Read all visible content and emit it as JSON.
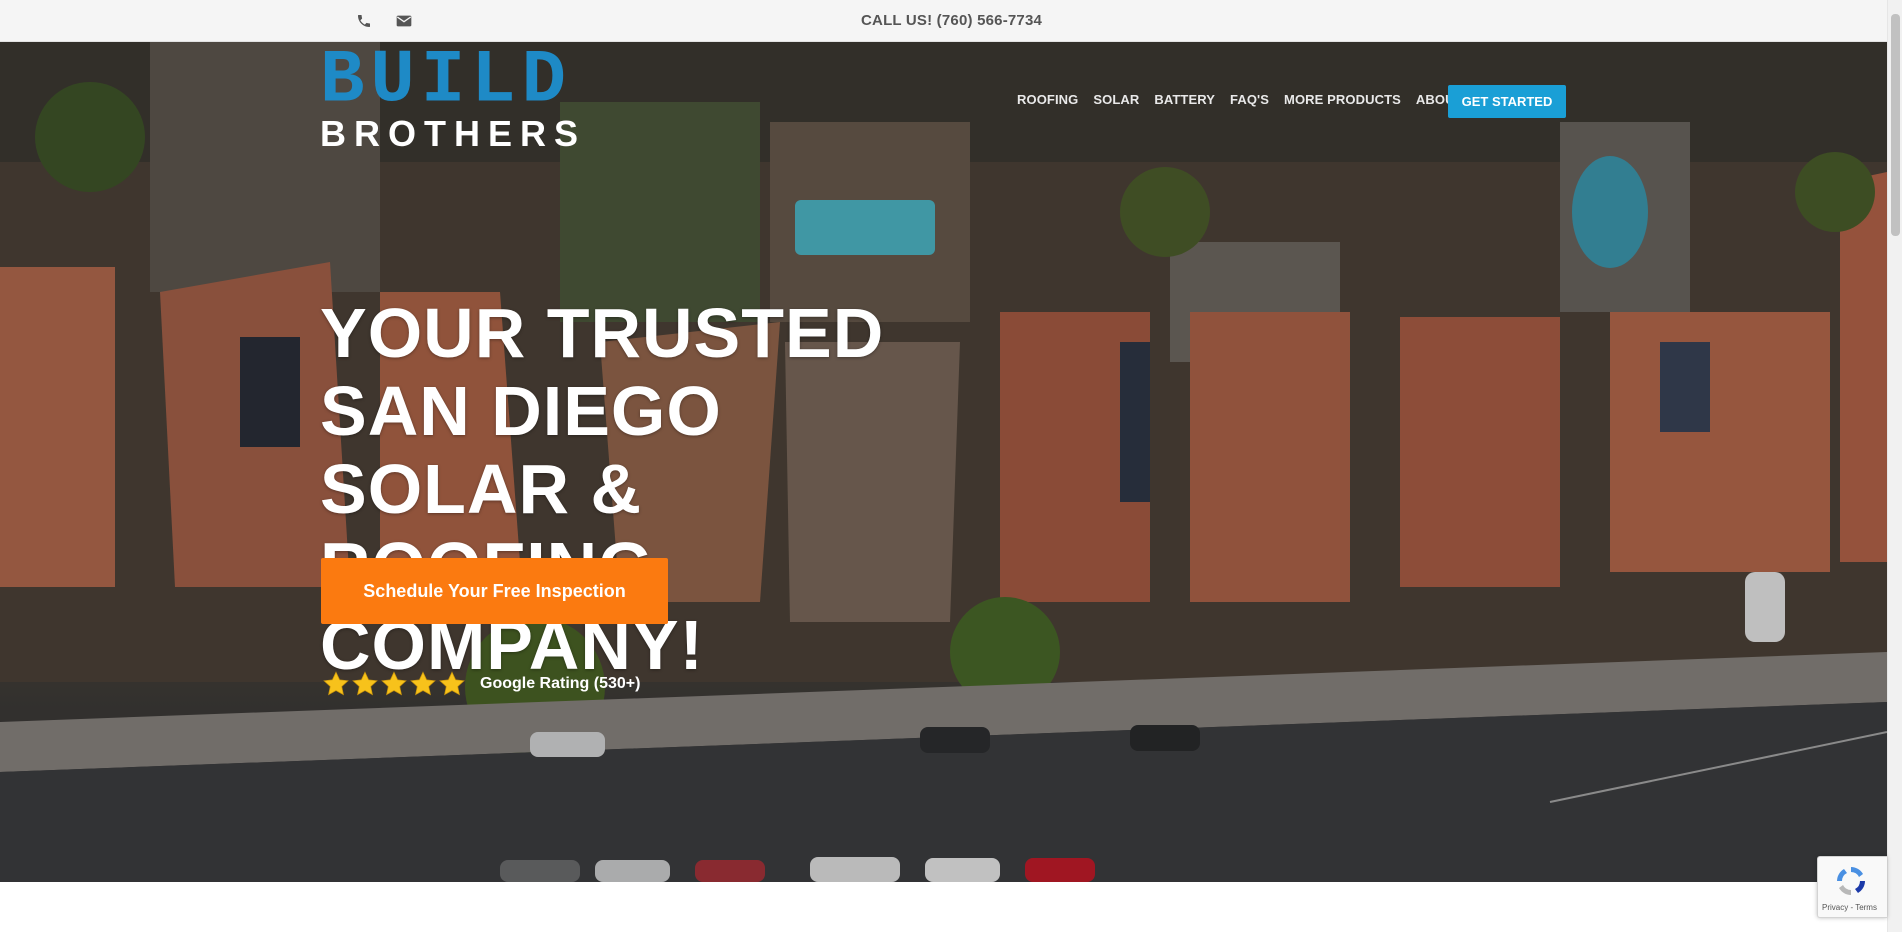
{
  "topbar": {
    "phone_icon": "phone-icon",
    "email_icon": "envelope-icon",
    "call_text": "CALL US! (760) 566-7734"
  },
  "logo": {
    "line1": "BUILD",
    "line2": "BROTHERS",
    "accent_color": "#1e8ac6"
  },
  "nav": {
    "items": [
      "ROOFING",
      "SOLAR",
      "BATTERY",
      "FAQ'S",
      "MORE PRODUCTS",
      "ABOUT US"
    ],
    "cta_label": "GET STARTED",
    "cta_color": "#1a9fd6"
  },
  "hero": {
    "headline": "YOUR TRUSTED SAN DIEGO SOLAR & ROOFING COMPANY!",
    "button_label": "Schedule Your Free Inspection",
    "button_color": "#fb7a10",
    "rating_stars": 5,
    "rating_text": "Google Rating (530+)",
    "star_color": "#f7c21b"
  },
  "recaptcha": {
    "text": "Privacy - Terms"
  }
}
